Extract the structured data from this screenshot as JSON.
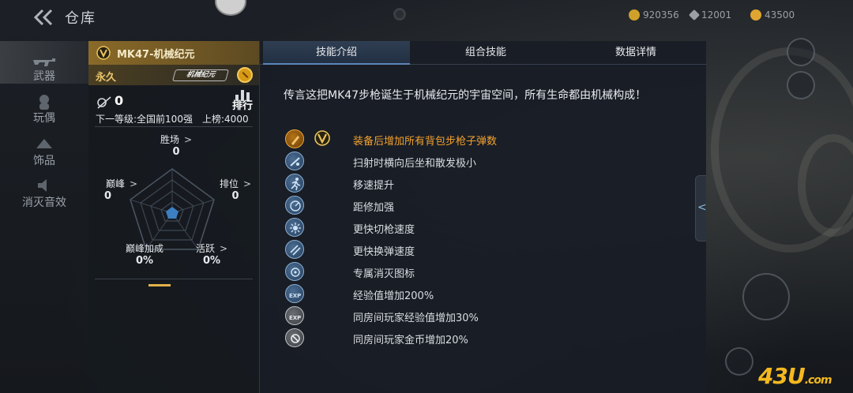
{
  "topbar": {
    "title": "仓库",
    "currencies": [
      {
        "name": "gold-coins",
        "value": "920356",
        "color": "#d0a12a"
      },
      {
        "name": "diamonds",
        "value": "12001",
        "color": "#9aa0a6"
      },
      {
        "name": "medals",
        "value": "43500",
        "color": "#e0a530"
      }
    ]
  },
  "nav": {
    "items": [
      {
        "label": "武器",
        "icon": "rifle-icon",
        "active": true
      },
      {
        "label": "玩偶",
        "icon": "doll-icon",
        "active": false
      },
      {
        "label": "饰品",
        "icon": "accessory-icon",
        "active": false
      },
      {
        "label": "消灭音效",
        "icon": "sound-icon",
        "active": false
      }
    ]
  },
  "card": {
    "weapon_name": "MK47-机械纪元",
    "duration": "永久",
    "brand_logo": "机械纪元",
    "kills": "0",
    "rank_label": "排行",
    "next_level": "下一等级:全国前100强",
    "list_value": "上榜:4000",
    "stats": [
      {
        "key": "胜场",
        "value": "0"
      },
      {
        "key": "排位",
        "value": "0"
      },
      {
        "key": "活跃",
        "value": "0%"
      },
      {
        "key": "巅峰加成",
        "value": "0%"
      },
      {
        "key": "巅峰",
        "value": "0"
      }
    ],
    "chevron": ">"
  },
  "panel": {
    "tabs": [
      {
        "label": "技能介绍",
        "active": true
      },
      {
        "label": "组合技能",
        "active": false
      },
      {
        "label": "数据详情",
        "active": false
      }
    ],
    "description": "传言这把MK47步枪诞生于机械纪元的宇宙空间，所有生命都由机械构成！",
    "skills": [
      {
        "text": "装备后增加所有背包步枪子弹数",
        "icon": "bullet-icon",
        "style": "gold",
        "highlight": true
      },
      {
        "text": "扫射时横向后坐和散发极小",
        "icon": "recoil-icon",
        "style": "blue",
        "highlight": false
      },
      {
        "text": "移速提升",
        "icon": "running-icon",
        "style": "blue",
        "highlight": false
      },
      {
        "text": "距修加强",
        "icon": "range-icon",
        "style": "blue",
        "highlight": false
      },
      {
        "text": "更快切枪速度",
        "icon": "switch-gun-icon",
        "style": "blue",
        "highlight": false
      },
      {
        "text": "更快换弹速度",
        "icon": "reload-icon",
        "style": "blue",
        "highlight": false
      },
      {
        "text": "专属消灭图标",
        "icon": "kill-mark-icon",
        "style": "blue",
        "highlight": false
      },
      {
        "text": "经验值增加200%",
        "icon": "exp-icon",
        "style": "blue",
        "highlight": false
      },
      {
        "text": "同房间玩家经验值增加30%",
        "icon": "room-exp-icon",
        "style": "grey",
        "highlight": false
      },
      {
        "text": "同房间玩家金币增加20%",
        "icon": "room-coin-icon",
        "style": "grey",
        "highlight": false
      }
    ],
    "side_arrow": "<"
  },
  "watermark": {
    "main": "43U",
    "suffix": ".com"
  }
}
